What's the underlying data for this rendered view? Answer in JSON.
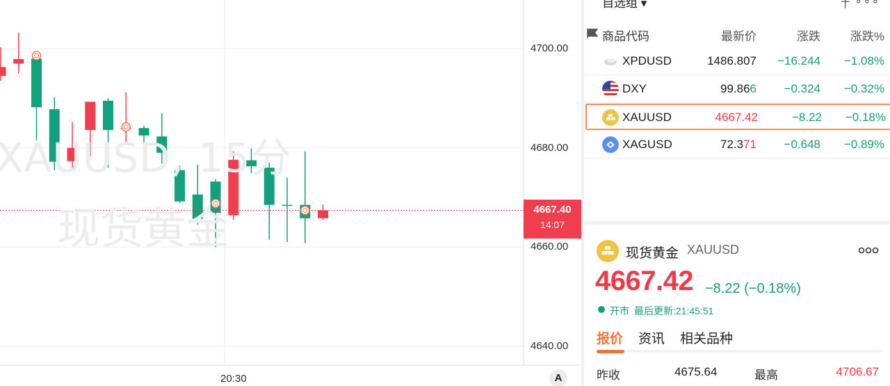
{
  "chart": {
    "watermark_symbol": "XAUUSD, 15分",
    "watermark_name": "现货黄金",
    "y_ticks": [
      "4700.00",
      "4680.00",
      "4660.00",
      "4640.00"
    ],
    "x_ticks": [
      "20:30"
    ],
    "current_price_label": "4667.40",
    "countdown_label": "14:07",
    "auto_scale_label": "A",
    "colors": {
      "up": "#ef3f4f",
      "down": "#13a07f",
      "grid": "#eeeeee",
      "price_line": "#ef3f4f",
      "marker": "#f07a52"
    }
  },
  "chart_data": {
    "type": "candlestick",
    "title": "",
    "ylim": [
      4620,
      4710
    ],
    "y_ticks": [
      4700,
      4680,
      4660,
      4640
    ],
    "x_tick": {
      "label": "20:30",
      "candle_index": 12.5
    },
    "current_price": 4667.4,
    "candles": [
      {
        "o": 4694.5,
        "h": 4700.3,
        "l": 4693.5,
        "c": 4696.3
      },
      {
        "o": 4697.0,
        "h": 4703.2,
        "l": 4695.0,
        "c": 4697.9
      },
      {
        "o": 4698.0,
        "h": 4698.5,
        "l": 4681.5,
        "c": 4688.2
      },
      {
        "o": 4687.8,
        "h": 4690.2,
        "l": 4675.5,
        "c": 4677.2
      },
      {
        "o": 4677.3,
        "h": 4685.2,
        "l": 4675.5,
        "c": 4680.0
      },
      {
        "o": 4683.6,
        "h": 4688.7,
        "l": 4678.3,
        "c": 4689.3
      },
      {
        "o": 4689.5,
        "h": 4690.0,
        "l": 4676.0,
        "c": 4683.6
      },
      {
        "o": 4684.0,
        "h": 4691.2,
        "l": 4681.0,
        "c": 4684.0
      },
      {
        "o": 4684.0,
        "h": 4684.5,
        "l": 4678.0,
        "c": 4682.5
      },
      {
        "o": 4682.3,
        "h": 4687.0,
        "l": 4676.8,
        "c": 4679.0
      },
      {
        "o": 4675.5,
        "h": 4676.4,
        "l": 4668.9,
        "c": 4669.2
      },
      {
        "o": 4670.6,
        "h": 4676.6,
        "l": 4664.5,
        "c": 4665.7
      },
      {
        "o": 4673.2,
        "h": 4673.7,
        "l": 4660.0,
        "c": 4666.9
      },
      {
        "o": 4666.4,
        "h": 4679.3,
        "l": 4665.5,
        "c": 4677.6
      },
      {
        "o": 4677.5,
        "h": 4679.9,
        "l": 4674.9,
        "c": 4676.3
      },
      {
        "o": 4676.0,
        "h": 4677.0,
        "l": 4661.5,
        "c": 4668.5
      },
      {
        "o": 4668.5,
        "h": 4674.0,
        "l": 4661.0,
        "c": 4668.3
      },
      {
        "o": 4668.5,
        "h": 4679.3,
        "l": 4660.8,
        "c": 4665.8
      },
      {
        "o": 4665.8,
        "h": 4668.6,
        "l": 4665.5,
        "c": 4667.4
      }
    ],
    "markers": [
      {
        "index": 1.9,
        "price": 4698.6,
        "filled": false
      },
      {
        "index": 6.9,
        "price": 4684.2,
        "filled": false
      },
      {
        "index": 11.9,
        "price": 4668.8,
        "filled": false
      },
      {
        "index": 16.9,
        "price": 4667.4,
        "filled": false
      }
    ]
  },
  "watchlist": {
    "group_label": "自选组 ▾",
    "group_tools": "┼ ∘∘∘",
    "headers": {
      "code": "商品代码",
      "last": "最新价",
      "change": "涨跌",
      "change_pct": "涨跌%"
    },
    "rows": [
      {
        "symbol": "XPDUSD",
        "last": "1486.807",
        "last_main": "1486.807",
        "last_tail": "",
        "change": "−16.244",
        "change_pct": "−1.08%",
        "icon": "palladium-icon",
        "icon_color": "#d6d6d6"
      },
      {
        "symbol": "DXY",
        "last": "99.866",
        "last_main": "99.86",
        "last_tail": "6",
        "change": "−0.324",
        "change_pct": "−0.32%",
        "icon": "us-flag-icon",
        "icon_color": "#2b4a9a"
      },
      {
        "symbol": "XAUUSD",
        "last": "4667.42",
        "last_main": "4667.42",
        "last_tail": "",
        "change": "−8.22",
        "change_pct": "−0.18%",
        "icon": "gold-icon",
        "icon_color": "#f1c243"
      },
      {
        "symbol": "XAGUSD",
        "last": "72.371",
        "last_main": "72.3",
        "last_tail": "71",
        "change": "−0.648",
        "change_pct": "−0.89%",
        "icon": "silver-icon",
        "icon_color": "#5b8ff0"
      }
    ]
  },
  "detail": {
    "name": "现货黄金",
    "code": "XAUUSD",
    "more_label": "∘∘∘",
    "price": "4667.42",
    "change": "−8.22 (−0.18%)",
    "status": "开市",
    "last_update": "最后更新:21:45:51",
    "tabs": [
      "报价",
      "资讯",
      "相关品种"
    ],
    "quote": {
      "prev_close_label": "昨收",
      "prev_close": "4675.64",
      "high_label": "最高",
      "high": "4706.67"
    }
  }
}
